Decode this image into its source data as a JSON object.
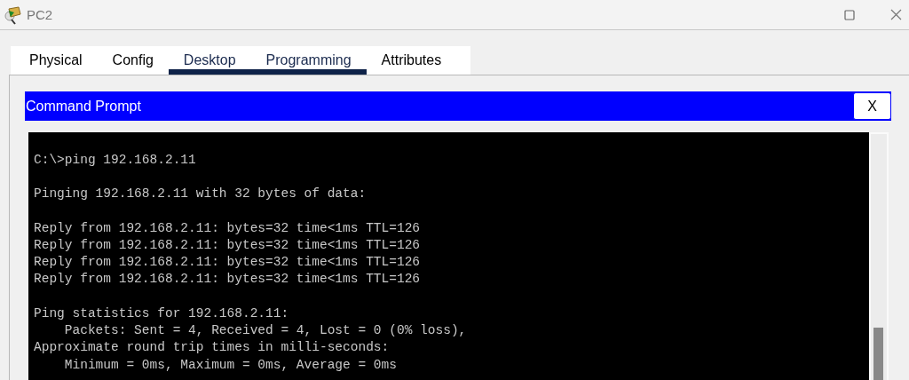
{
  "window": {
    "title": "PC2"
  },
  "tabs": [
    {
      "label": "Physical",
      "selected": false
    },
    {
      "label": "Config",
      "selected": false
    },
    {
      "label": "Desktop",
      "selected": true
    },
    {
      "label": "Programming",
      "selected": true
    },
    {
      "label": "Attributes",
      "selected": false
    }
  ],
  "panel": {
    "title": "Command Prompt",
    "close_label": "X"
  },
  "terminal": {
    "blocks": [
      [
        "C:\\>ping 192.168.2.11"
      ],
      [
        "Pinging 192.168.2.11 with 32 bytes of data:"
      ],
      [
        "Reply from 192.168.2.11: bytes=32 time<1ms TTL=126",
        "Reply from 192.168.2.11: bytes=32 time<1ms TTL=126",
        "Reply from 192.168.2.11: bytes=32 time<1ms TTL=126",
        "Reply from 192.168.2.11: bytes=32 time<1ms TTL=126"
      ],
      [
        "Ping statistics for 192.168.2.11:",
        "    Packets: Sent = 4, Received = 4, Lost = 0 (0% loss),",
        "Approximate round trip times in milli-seconds:",
        "    Minimum = 0ms, Maximum = 0ms, Average = 0ms"
      ]
    ]
  }
}
